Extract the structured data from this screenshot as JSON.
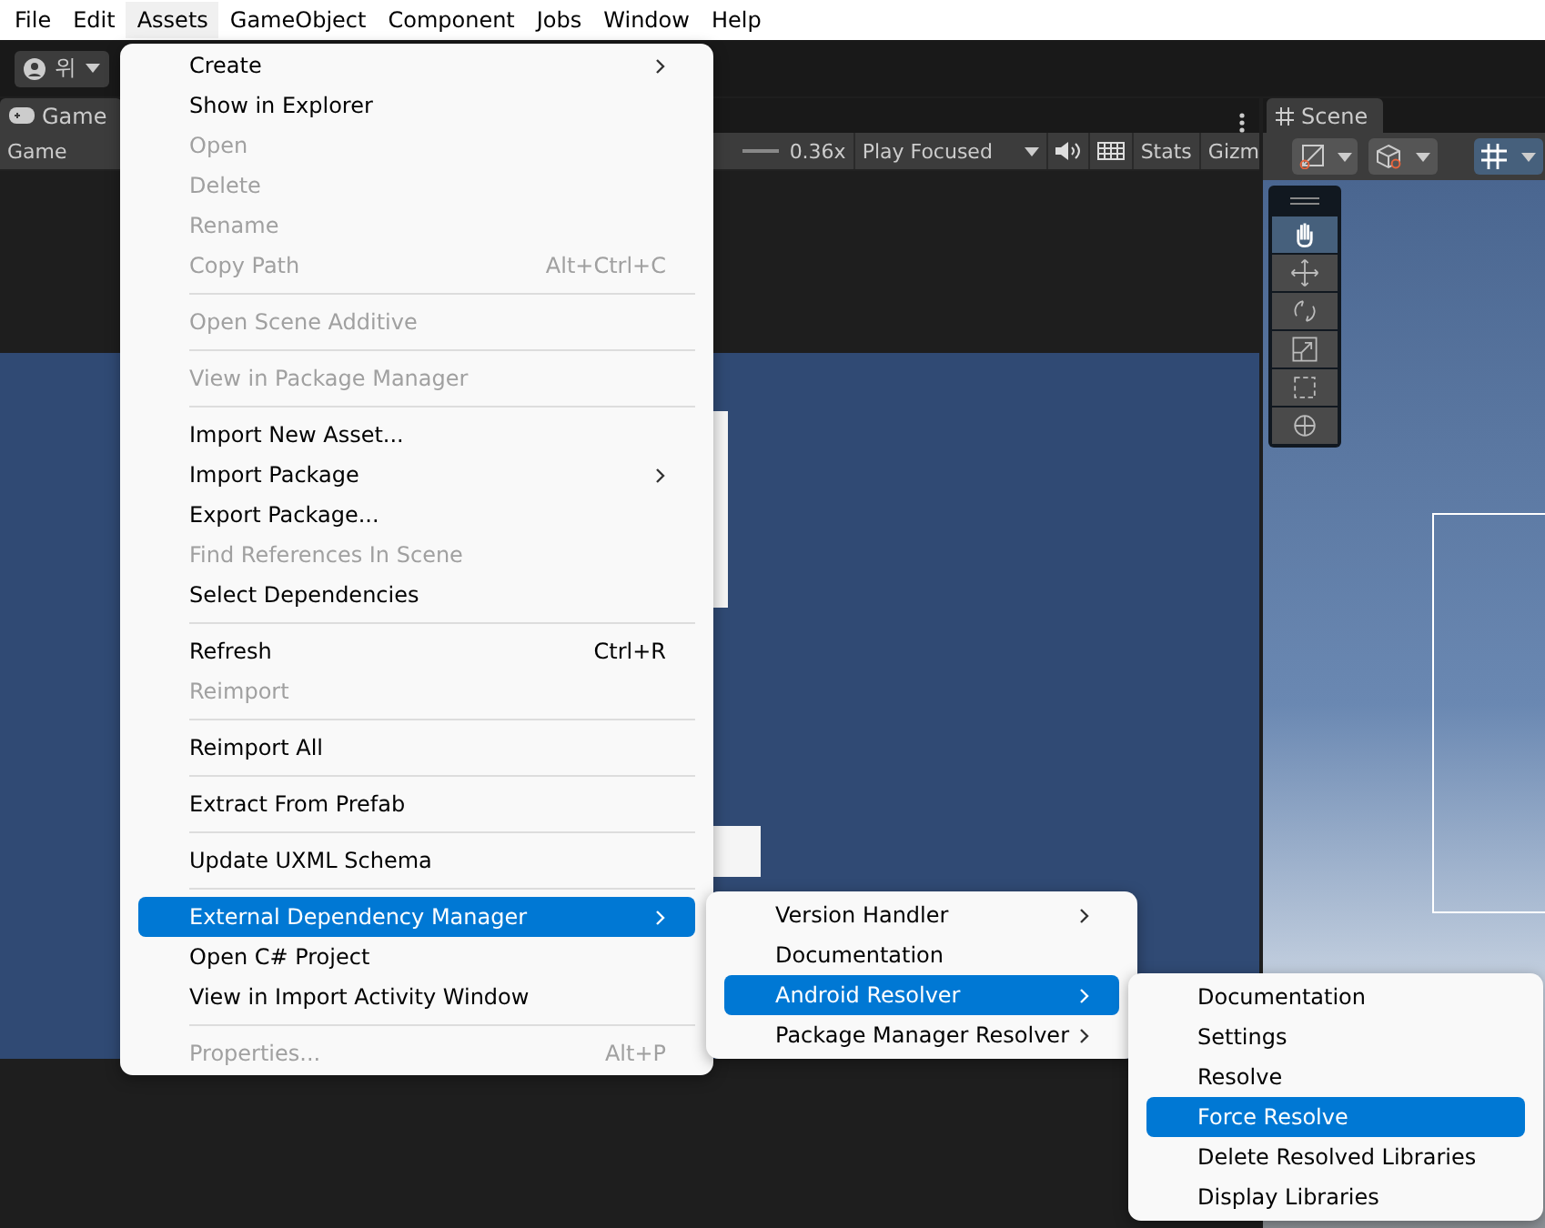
{
  "menubar": [
    {
      "label": "File",
      "selected": false
    },
    {
      "label": "Edit",
      "selected": false
    },
    {
      "label": "Assets",
      "selected": true
    },
    {
      "label": "GameObject",
      "selected": false
    },
    {
      "label": "Component",
      "selected": false
    },
    {
      "label": "Jobs",
      "selected": false
    },
    {
      "label": "Window",
      "selected": false
    },
    {
      "label": "Help",
      "selected": false
    }
  ],
  "toolbar": {
    "account": "위"
  },
  "game_panel": {
    "tab": "Game",
    "display": "Game",
    "scale": "0.36x",
    "play_mode": "Play Focused",
    "stats": "Stats",
    "gizmos": "Gizm"
  },
  "scene_panel": {
    "tab": "Scene",
    "tools": [
      {
        "selected": true
      },
      {
        "selected": false
      },
      {
        "selected": false
      },
      {
        "selected": false
      },
      {
        "selected": false
      },
      {
        "selected": false
      }
    ]
  },
  "assets_menu": [
    {
      "kind": "item",
      "label": "Create",
      "submenu": true,
      "disabled": false,
      "selected": false
    },
    {
      "kind": "item",
      "label": "Show in Explorer",
      "disabled": false,
      "selected": false
    },
    {
      "kind": "item",
      "label": "Open",
      "disabled": true,
      "selected": false
    },
    {
      "kind": "item",
      "label": "Delete",
      "disabled": true,
      "selected": false
    },
    {
      "kind": "item",
      "label": "Rename",
      "disabled": true,
      "selected": false
    },
    {
      "kind": "item",
      "label": "Copy Path",
      "shortcut": "Alt+Ctrl+C",
      "disabled": true,
      "selected": false
    },
    {
      "kind": "separator"
    },
    {
      "kind": "item",
      "label": "Open Scene Additive",
      "disabled": true,
      "selected": false
    },
    {
      "kind": "separator"
    },
    {
      "kind": "item",
      "label": "View in Package Manager",
      "disabled": true,
      "selected": false
    },
    {
      "kind": "separator"
    },
    {
      "kind": "item",
      "label": "Import New Asset...",
      "disabled": false,
      "selected": false
    },
    {
      "kind": "item",
      "label": "Import Package",
      "submenu": true,
      "disabled": false,
      "selected": false
    },
    {
      "kind": "item",
      "label": "Export Package...",
      "disabled": false,
      "selected": false
    },
    {
      "kind": "item",
      "label": "Find References In Scene",
      "disabled": true,
      "selected": false
    },
    {
      "kind": "item",
      "label": "Select Dependencies",
      "disabled": false,
      "selected": false
    },
    {
      "kind": "separator"
    },
    {
      "kind": "item",
      "label": "Refresh",
      "shortcut": "Ctrl+R",
      "disabled": false,
      "selected": false
    },
    {
      "kind": "item",
      "label": "Reimport",
      "disabled": true,
      "selected": false
    },
    {
      "kind": "separator"
    },
    {
      "kind": "item",
      "label": "Reimport All",
      "disabled": false,
      "selected": false
    },
    {
      "kind": "separator"
    },
    {
      "kind": "item",
      "label": "Extract From Prefab",
      "disabled": false,
      "selected": false
    },
    {
      "kind": "separator"
    },
    {
      "kind": "item",
      "label": "Update UXML Schema",
      "disabled": false,
      "selected": false
    },
    {
      "kind": "separator"
    },
    {
      "kind": "item",
      "label": "External Dependency Manager",
      "submenu": true,
      "disabled": false,
      "selected": true
    },
    {
      "kind": "item",
      "label": "Open C# Project",
      "disabled": false,
      "selected": false
    },
    {
      "kind": "item",
      "label": "View in Import Activity Window",
      "disabled": false,
      "selected": false
    },
    {
      "kind": "separator"
    },
    {
      "kind": "item",
      "label": "Properties...",
      "shortcut": "Alt+P",
      "disabled": true,
      "selected": false
    }
  ],
  "edm_menu": [
    {
      "kind": "item",
      "label": "Version Handler",
      "submenu": true,
      "disabled": false,
      "selected": false
    },
    {
      "kind": "item",
      "label": "Documentation",
      "disabled": false,
      "selected": false
    },
    {
      "kind": "item",
      "label": "Android Resolver",
      "submenu": true,
      "disabled": false,
      "selected": true
    },
    {
      "kind": "item",
      "label": "Package Manager Resolver",
      "submenu": true,
      "disabled": false,
      "selected": false
    }
  ],
  "android_resolver_menu": [
    {
      "kind": "item",
      "label": "Documentation",
      "disabled": false,
      "selected": false
    },
    {
      "kind": "item",
      "label": "Settings",
      "disabled": false,
      "selected": false
    },
    {
      "kind": "item",
      "label": "Resolve",
      "disabled": false,
      "selected": false
    },
    {
      "kind": "item",
      "label": "Force Resolve",
      "disabled": false,
      "selected": true
    },
    {
      "kind": "item",
      "label": "Delete Resolved Libraries",
      "disabled": false,
      "selected": false
    },
    {
      "kind": "item",
      "label": "Display Libraries",
      "disabled": false,
      "selected": false
    }
  ]
}
